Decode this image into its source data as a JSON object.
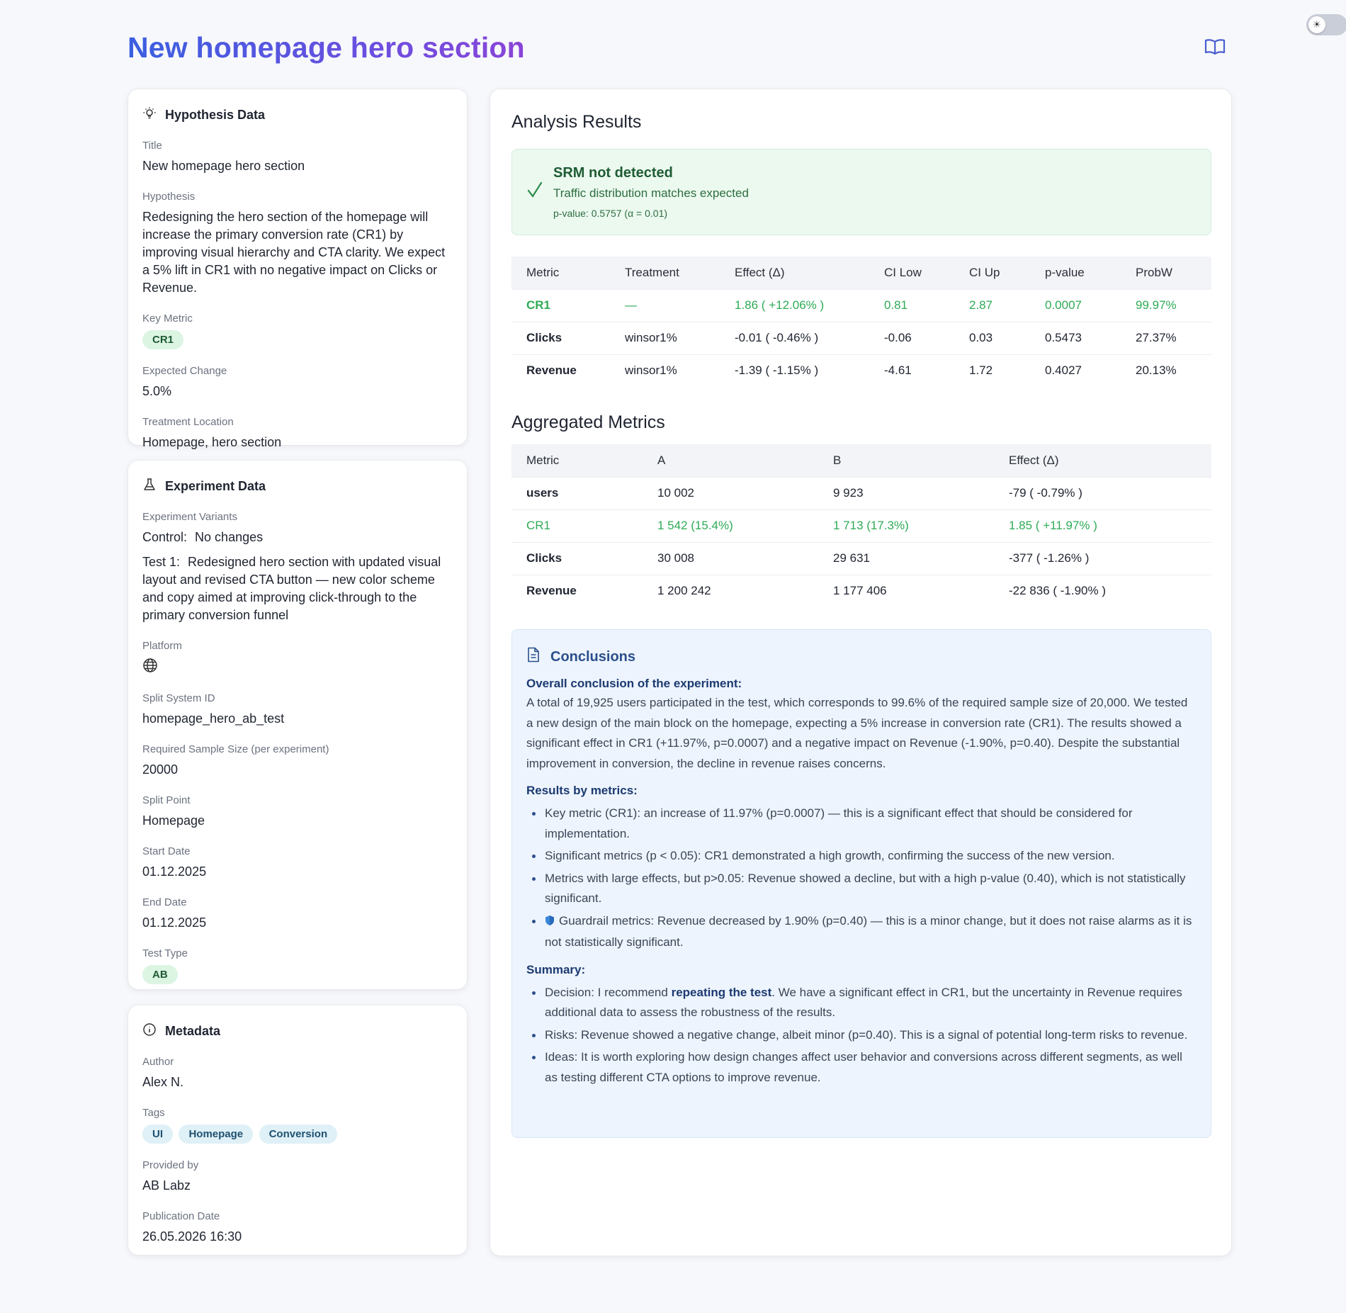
{
  "page": {
    "title": "New homepage hero section",
    "theme_toggle_icon": "sun-icon",
    "docs_icon": "book-icon"
  },
  "colors": {
    "title_gradient_start": "#3a5fe0",
    "title_gradient_end": "#8a44d8",
    "significant_green": "#2eab55",
    "srm_bg": "#ecf9ef",
    "conclusions_bg": "#edf4fd"
  },
  "hypothesis": {
    "heading": "Hypothesis Data",
    "icon": "lightbulb-icon",
    "title_label": "Title",
    "title_value": "New homepage hero section",
    "hypothesis_label": "Hypothesis",
    "hypothesis_value": "Redesigning the hero section of the homepage will increase the primary conversion rate (CR1) by improving visual hierarchy and CTA clarity. We expect a 5% lift in CR1 with no negative impact on Clicks or Revenue.",
    "key_metric_label": "Key Metric",
    "key_metric_value": "CR1",
    "expected_change_label": "Expected Change",
    "expected_change_value": "5.0%",
    "treatment_location_label": "Treatment Location",
    "treatment_location_value": "Homepage, hero section"
  },
  "experiment": {
    "heading": "Experiment Data",
    "icon": "flask-icon",
    "variants_label": "Experiment Variants",
    "control_label": "Control:",
    "control_value": "No changes",
    "test1_label": "Test 1:",
    "test1_value": "Redesigned hero section with updated visual layout and revised CTA button — new color scheme and copy aimed at improving click-through to the primary conversion funnel",
    "platform_label": "Platform",
    "platform_icon": "globe-icon",
    "split_id_label": "Split System ID",
    "split_id_value": "homepage_hero_ab_test",
    "sample_size_label": "Required Sample Size (per experiment)",
    "sample_size_value": "20000",
    "split_point_label": "Split Point",
    "split_point_value": "Homepage",
    "start_date_label": "Start Date",
    "start_date_value": "01.12.2025",
    "end_date_label": "End Date",
    "end_date_value": "01.12.2025",
    "test_type_label": "Test Type",
    "test_type_value": "AB"
  },
  "metadata": {
    "heading": "Metadata",
    "icon": "info-icon",
    "author_label": "Author",
    "author_value": "Alex N.",
    "tags_label": "Tags",
    "tags": [
      "UI",
      "Homepage",
      "Conversion"
    ],
    "provided_by_label": "Provided by",
    "provided_by_value": "AB Labz",
    "publication_date_label": "Publication Date",
    "publication_date_value": "26.05.2026 16:30"
  },
  "analysis": {
    "heading": "Analysis Results",
    "srm": {
      "icon": "check-icon",
      "title": "SRM not detected",
      "subtitle": "Traffic distribution matches expected",
      "pvalue": "p-value: 0.5757 (α = 0.01)"
    },
    "results_table": {
      "headers": [
        "Metric",
        "Treatment",
        "Effect (Δ)",
        "CI Low",
        "CI Up",
        "p-value",
        "ProbW"
      ],
      "rows": [
        {
          "cells": [
            "CR1",
            "—",
            "1.86 ( +12.06% )",
            "0.81",
            "2.87",
            "0.0007",
            "99.97%"
          ],
          "significant": true
        },
        {
          "cells": [
            "Clicks",
            "winsor1%",
            "-0.01 ( -0.46% )",
            "-0.06",
            "0.03",
            "0.5473",
            "27.37%"
          ],
          "significant": false
        },
        {
          "cells": [
            "Revenue",
            "winsor1%",
            "-1.39 ( -1.15% )",
            "-4.61",
            "1.72",
            "0.4027",
            "20.13%"
          ],
          "significant": false
        }
      ]
    }
  },
  "aggregated": {
    "heading": "Aggregated Metrics",
    "headers": [
      "Metric",
      "A",
      "B",
      "Effect (Δ)"
    ],
    "rows": [
      {
        "cells": [
          "users",
          "10 002",
          "9 923",
          "-79 ( -0.79% )"
        ],
        "significant": false
      },
      {
        "cells": [
          "CR1",
          "1 542 (15.4%)",
          "1 713 (17.3%)",
          "1.85 ( +11.97% )"
        ],
        "significant": true
      },
      {
        "cells": [
          "Clicks",
          "30 008",
          "29 631",
          "-377 ( -1.26% )"
        ],
        "significant": false
      },
      {
        "cells": [
          "Revenue",
          "1 200 242",
          "1 177 406",
          "-22 836 ( -1.90% )"
        ],
        "significant": false
      }
    ]
  },
  "conclusions": {
    "heading": "Conclusions",
    "icon": "document-icon",
    "overall_heading": "Overall conclusion of the experiment:",
    "overall_text": "A total of 19,925 users participated in the test, which corresponds to 99.6% of the required sample size of 20,000. We tested a new design of the main block on the homepage, expecting a 5% increase in conversion rate (CR1). The results showed a significant effect in CR1 (+11.97%, p=0.0007) and a negative impact on Revenue (-1.90%, p=0.40). Despite the substantial improvement in conversion, the decline in revenue raises concerns.",
    "results_heading": "Results by metrics:",
    "results_items": [
      "Key metric (CR1): an increase of 11.97% (p=0.0007) — this is a significant effect that should be considered for implementation.",
      "Significant metrics (p < 0.05): CR1 demonstrated a high growth, confirming the success of the new version.",
      "Metrics with large effects, but p>0.05: Revenue showed a decline, but with a high p-value (0.40), which is not statistically significant."
    ],
    "guardrail_icon": "shield-icon",
    "guardrail_item": "Guardrail metrics: Revenue decreased by 1.90% (p=0.40) — this is a minor change, but it does not raise alarms as it is not statistically significant.",
    "summary_heading": "Summary:",
    "decision_prefix": "Decision: I recommend ",
    "decision_bold": "repeating the test",
    "decision_suffix": ". We have a significant effect in CR1, but the uncertainty in Revenue requires additional data to assess the robustness of the results.",
    "summary_items": [
      "Risks: Revenue showed a negative change, albeit minor (p=0.40). This is a signal of potential long-term risks to revenue.",
      "Ideas: It is worth exploring how design changes affect user behavior and conversions across different segments, as well as testing different CTA options to improve revenue."
    ]
  }
}
